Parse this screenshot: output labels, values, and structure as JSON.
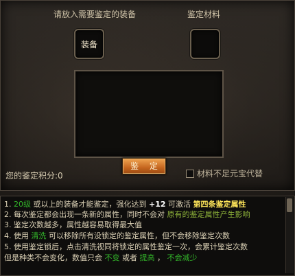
{
  "equip_slot": {
    "title": "请放入需要鉴定的装备",
    "label": "装备"
  },
  "material_slot": {
    "title": "鉴定材料",
    "label": ""
  },
  "appraise_button": "鉴 定",
  "score": {
    "label": "您的鉴定积分",
    "value": ":0"
  },
  "substitute": {
    "label": "材料不足元宝代替",
    "checked": false
  },
  "instructions": [
    {
      "num": "1.",
      "parts": [
        {
          "t": "20级",
          "c": "g"
        },
        {
          "t": " 或以上的装备才能鉴定，强化达到 ",
          "c": ""
        },
        {
          "t": "+12",
          "c": "w"
        },
        {
          "t": " 可激活 ",
          "c": ""
        },
        {
          "t": "第四条鉴定属性",
          "c": "y"
        }
      ]
    },
    {
      "num": "2.",
      "parts": [
        {
          "t": "每次鉴定都会出现一条新的属性，同时不会对 ",
          "c": ""
        },
        {
          "t": "原有的鉴定属性产生影响",
          "c": "o"
        }
      ]
    },
    {
      "num": "3.",
      "parts": [
        {
          "t": "鉴定次数越多，属性越容易取得最大值",
          "c": ""
        }
      ]
    },
    {
      "num": "4.",
      "parts": [
        {
          "t": "使用 ",
          "c": ""
        },
        {
          "t": "清洗",
          "c": "g"
        },
        {
          "t": " 可以移除所有没锁定的鉴定属性，但不会移除鉴定次数",
          "c": ""
        }
      ]
    },
    {
      "num": "5.",
      "parts": [
        {
          "t": "使用鉴定锁后，点击清洗视同将锁定的属性鉴定一次，会累计鉴定次数",
          "c": ""
        }
      ]
    },
    {
      "num": "",
      "parts": [
        {
          "t": "但是种类不会变化，数值只会 ",
          "c": ""
        },
        {
          "t": "不变",
          "c": "g"
        },
        {
          "t": " 或者 ",
          "c": ""
        },
        {
          "t": "提高",
          "c": "g"
        },
        {
          "t": " ， ",
          "c": ""
        },
        {
          "t": "不会减少",
          "c": "g"
        }
      ]
    }
  ]
}
